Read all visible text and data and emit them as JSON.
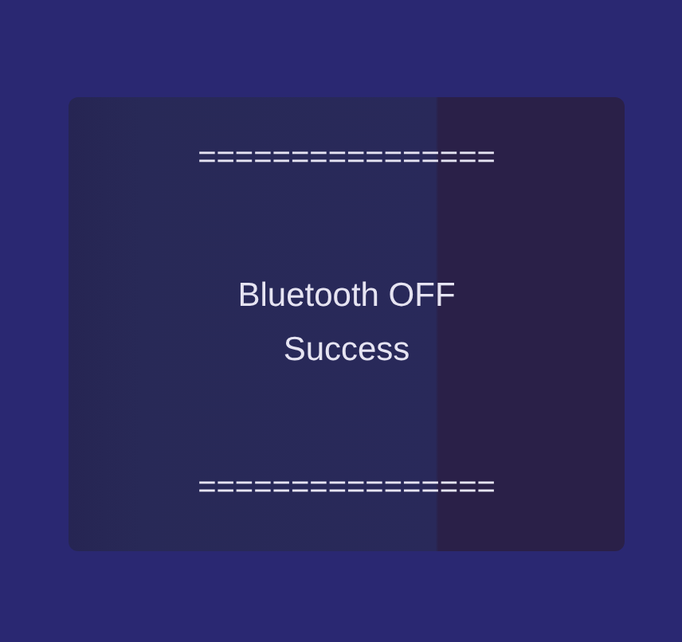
{
  "toast": {
    "lines": [
      "================",
      "Bluetooth OFF\nSuccess",
      "================"
    ]
  }
}
